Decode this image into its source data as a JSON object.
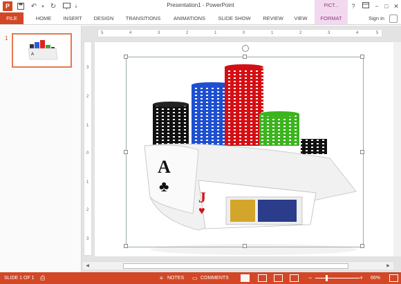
{
  "titlebar": {
    "title": "Presentation1 - PowerPoint",
    "app_icon": "P",
    "context_tab": "PICT...",
    "help": "?",
    "controls": [
      "restore-ribbon-icon",
      "minimize-icon",
      "maximize-icon",
      "close-icon"
    ]
  },
  "ribbon": {
    "tabs": [
      "FILE",
      "HOME",
      "INSERT",
      "DESIGN",
      "TRANSITIONS",
      "ANIMATIONS",
      "SLIDE SHOW",
      "REVIEW",
      "VIEW",
      "FORMAT"
    ],
    "signin": "Sign in"
  },
  "rulers": {
    "horizontal": [
      "5",
      "4",
      "3",
      "2",
      "1",
      "0",
      "1",
      "2",
      "3",
      "4",
      "5"
    ],
    "vertical": [
      "3",
      "2",
      "1",
      "0",
      "1",
      "2",
      "3"
    ]
  },
  "thumbnails": {
    "slide_number": "1"
  },
  "slide": {
    "image_name": "poker-chips-cards-image",
    "card_left_rank": "A",
    "card_left_suit": "♣",
    "card_right_rank": "J",
    "card_right_suit": "♥"
  },
  "statusbar": {
    "slide_info": "SLIDE 1 OF 1",
    "notes": "NOTES",
    "comments": "COMMENTS",
    "zoom": "66%",
    "zoom_minus": "−",
    "zoom_plus": "+"
  },
  "colors": {
    "accent": "#d24726",
    "format_tab": "#f3d9ef",
    "workspace": "#e3e3e3"
  }
}
